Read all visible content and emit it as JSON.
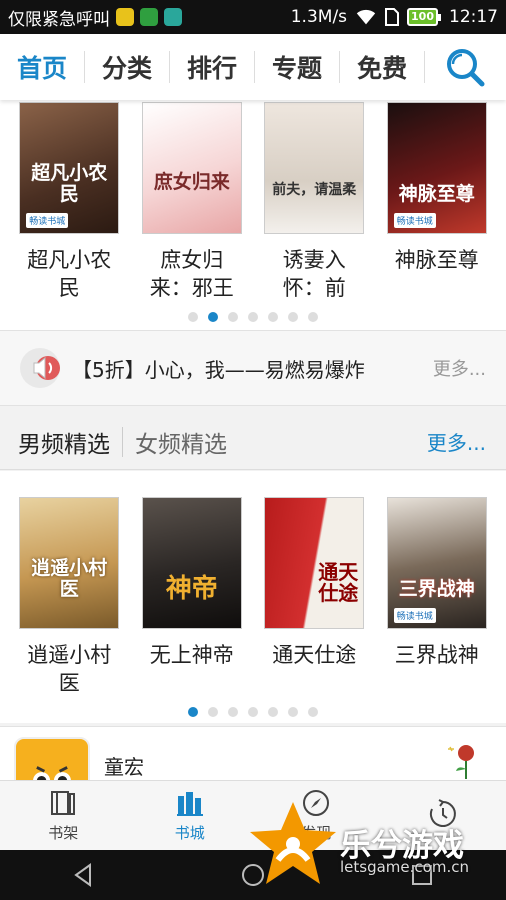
{
  "status_bar": {
    "carrier": "仅限紧急呼叫",
    "speed": "1.3M/s",
    "battery": "100",
    "time": "12:17"
  },
  "top_tabs": [
    {
      "label": "首页",
      "active": true
    },
    {
      "label": "分类",
      "active": false
    },
    {
      "label": "排行",
      "active": false
    },
    {
      "label": "专题",
      "active": false
    },
    {
      "label": "免费",
      "active": false
    }
  ],
  "featured_books": [
    {
      "title_line1": "超凡小农",
      "title_line2": "民",
      "cover_text": "超凡小农民",
      "cover_color": "#6b4a3a",
      "badge": "畅读书城"
    },
    {
      "title_line1": "庶女归",
      "title_line2": "来：邪王",
      "cover_text": "庶女归来",
      "cover_color": "#f3d7d2",
      "badge": ""
    },
    {
      "title_line1": "诱妻入",
      "title_line2": "怀：前",
      "cover_text": "前夫，请温柔",
      "cover_color": "#e8e2dc",
      "badge": ""
    },
    {
      "title_line1": "神脉至尊",
      "title_line2": "",
      "cover_text": "神脉至尊",
      "cover_color": "#3a1010",
      "badge": "畅读书城"
    }
  ],
  "featured_dots": {
    "count": 7,
    "active_index": 1
  },
  "promo": {
    "text": "【5折】小心，我——易燃易爆炸",
    "more": "更多..."
  },
  "section": {
    "tab_active": "男频精选",
    "tab_inactive": "女频精选",
    "more": "更多..."
  },
  "section_books": [
    {
      "title_line1": "逍遥小村",
      "title_line2": "医",
      "cover_text": "逍遥小村医",
      "cover_color": "#c9a063",
      "badge": ""
    },
    {
      "title_line1": "无上神帝",
      "title_line2": "",
      "cover_text": "神帝",
      "cover_color": "#2a2624",
      "badge": ""
    },
    {
      "title_line1": "通天仕途",
      "title_line2": "",
      "cover_text": "通天仕途",
      "cover_color": "#b71c1c",
      "badge": ""
    },
    {
      "title_line1": "三界战神",
      "title_line2": "",
      "cover_text": "三界战神",
      "cover_color": "#3e3b38",
      "badge": "畅读书城"
    }
  ],
  "section_dots": {
    "count": 7,
    "active_index": 0
  },
  "user_row": {
    "name": "童宏"
  },
  "bottom_nav": [
    {
      "label": "书架",
      "icon": "bookshelf-icon",
      "active": false
    },
    {
      "label": "书城",
      "icon": "bookstore-icon",
      "active": true
    },
    {
      "label": "发现",
      "icon": "compass-icon",
      "active": false
    },
    {
      "label": "",
      "icon": "history-icon",
      "active": false
    }
  ],
  "watermark": {
    "text": "乐兮游戏",
    "url": "letsgame.com.cn"
  },
  "colors": {
    "accent": "#1a86c8",
    "status_bar": "#111111"
  }
}
